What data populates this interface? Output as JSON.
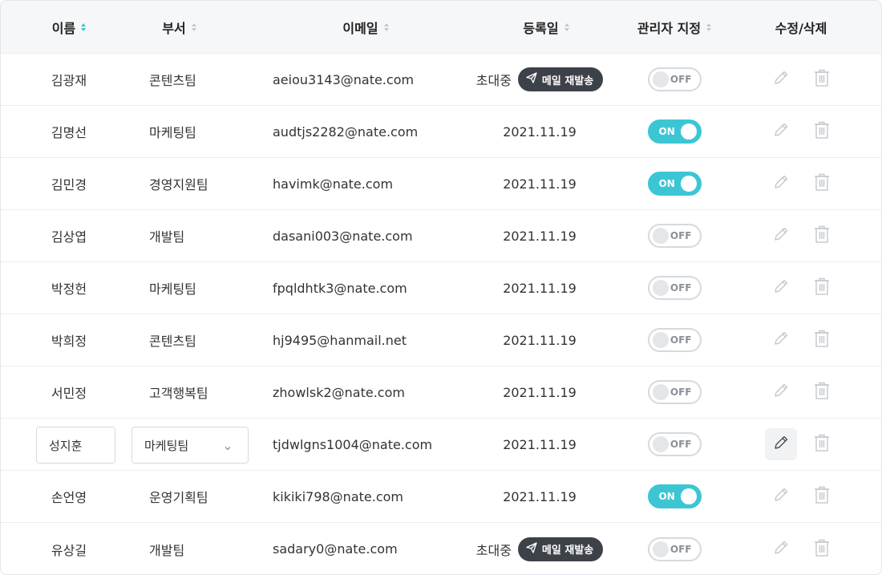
{
  "header": {
    "name": "이름",
    "dept": "부서",
    "email": "이메일",
    "registered": "등록일",
    "admin": "관리자 지정",
    "actions": "수정/삭제"
  },
  "labels": {
    "invite_pending": "초대중",
    "resend_mail": "메일 재발송",
    "toggle_on": "ON",
    "toggle_off": "OFF"
  },
  "colors": {
    "accent": "#3cc6d4",
    "resend_button": "#3d4148",
    "header_bg": "#f6f7f9"
  },
  "rows": [
    {
      "name": "김광재",
      "dept": "콘텐츠팀",
      "email": "aeiou3143@nate.com",
      "date": "",
      "status": "invited",
      "admin": false
    },
    {
      "name": "김명선",
      "dept": "마케팅팀",
      "email": "audtjs2282@nate.com",
      "date": "2021.11.19",
      "status": "registered",
      "admin": true
    },
    {
      "name": "김민경",
      "dept": "경영지원팀",
      "email": "havimk@nate.com",
      "date": "2021.11.19",
      "status": "registered",
      "admin": true
    },
    {
      "name": "김상엽",
      "dept": "개발팀",
      "email": "dasani003@nate.com",
      "date": "2021.11.19",
      "status": "registered",
      "admin": false
    },
    {
      "name": "박정헌",
      "dept": "마케팅팀",
      "email": "fpqldhtk3@nate.com",
      "date": "2021.11.19",
      "status": "registered",
      "admin": false
    },
    {
      "name": "박희정",
      "dept": "콘텐츠팀",
      "email": "hj9495@hanmail.net",
      "date": "2021.11.19",
      "status": "registered",
      "admin": false
    },
    {
      "name": "서민정",
      "dept": "고객행복팀",
      "email": "zhowlsk2@nate.com",
      "date": "2021.11.19",
      "status": "registered",
      "admin": false
    },
    {
      "name": "성지훈",
      "dept": "마케팅팀",
      "email": "tjdwlgns1004@nate.com",
      "date": "2021.11.19",
      "status": "registered",
      "admin": false,
      "editing": true
    },
    {
      "name": "손언영",
      "dept": "운영기획팀",
      "email": "kikiki798@nate.com",
      "date": "2021.11.19",
      "status": "registered",
      "admin": true
    },
    {
      "name": "유상길",
      "dept": "개발팀",
      "email": "sadary0@nate.com",
      "date": "",
      "status": "invited",
      "admin": false
    }
  ]
}
